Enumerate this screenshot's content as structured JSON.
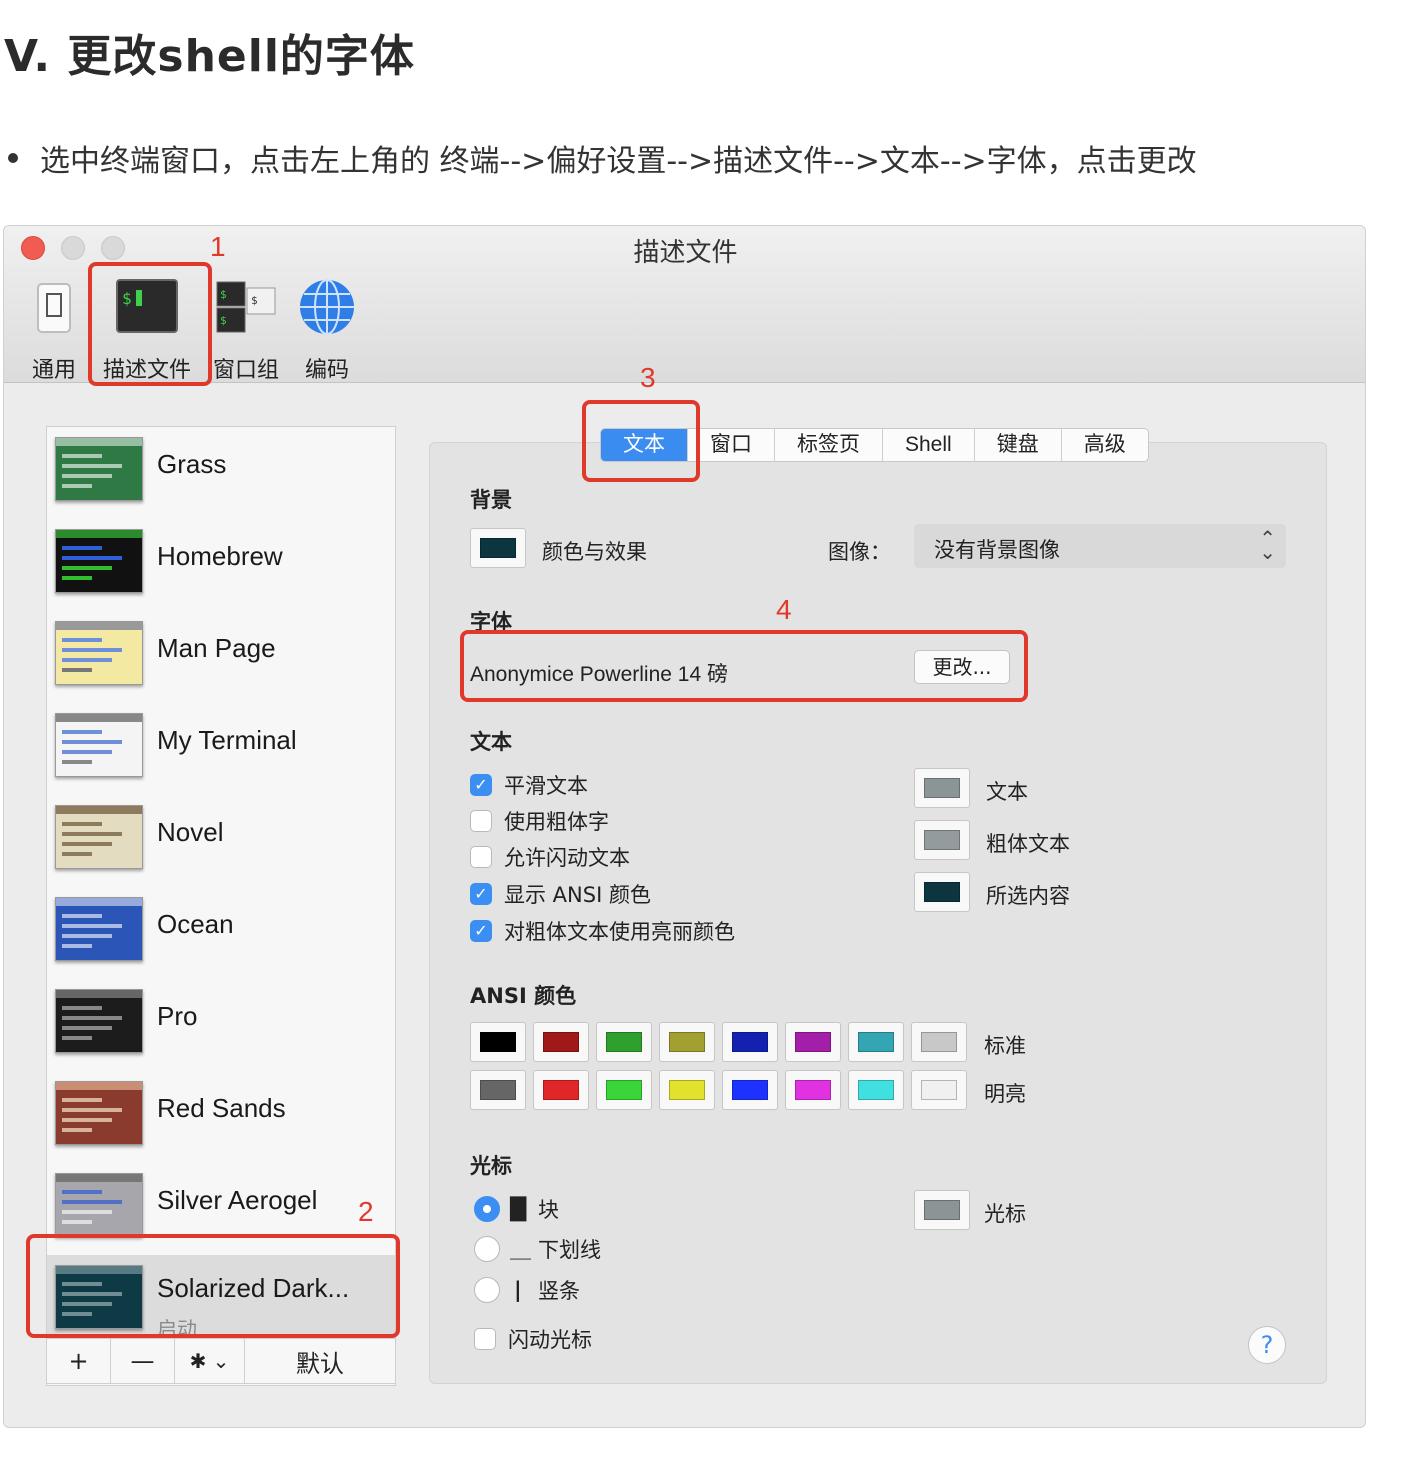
{
  "heading": "V. 更改shell的字体",
  "instruction": "选中终端窗口，点击左上角的 终端-->偏好设置-->描述文件-->文本-->字体，点击更改",
  "window": {
    "title": "描述文件",
    "toolbar": [
      {
        "label": "通用",
        "icon": "phone-icon"
      },
      {
        "label": "描述文件",
        "icon": "terminal-icon"
      },
      {
        "label": "窗口组",
        "icon": "window-group-icon"
      },
      {
        "label": "编码",
        "icon": "globe-icon"
      }
    ]
  },
  "annotations": [
    "1",
    "2",
    "3",
    "4"
  ],
  "profiles": [
    {
      "name": "Grass",
      "color": "#2f7a44"
    },
    {
      "name": "Homebrew",
      "color": "#111111"
    },
    {
      "name": "Man Page",
      "color": "#f3e9a2"
    },
    {
      "name": "My Terminal",
      "color": "#f4f4f4"
    },
    {
      "name": "Novel",
      "color": "#e3dcc1"
    },
    {
      "name": "Ocean",
      "color": "#2b56b8"
    },
    {
      "name": "Pro",
      "color": "#1c1c1c"
    },
    {
      "name": "Red Sands",
      "color": "#8a3b2e"
    },
    {
      "name": "Silver Aerogel",
      "color": "#a6a6ac"
    },
    {
      "name": "Solarized Dark...",
      "color": "#0d3a44",
      "sub": "启动"
    }
  ],
  "list_buttons": {
    "add": "+",
    "remove": "—",
    "gear": "✱ ⌄",
    "default": "默认"
  },
  "tabs": [
    "文本",
    "窗口",
    "标签页",
    "Shell",
    "键盘",
    "高级"
  ],
  "background": {
    "section": "背景",
    "color_effect": "颜色与效果",
    "image_label": "图像：",
    "image_value": "没有背景图像"
  },
  "font": {
    "section": "字体",
    "value": "Anonymice Powerline 14 磅",
    "change_button": "更改..."
  },
  "text": {
    "section": "文本",
    "options": [
      {
        "label": "平滑文本",
        "checked": true
      },
      {
        "label": "使用粗体字",
        "checked": false
      },
      {
        "label": "允许闪动文本",
        "checked": false
      },
      {
        "label": "显示 ANSI 颜色",
        "checked": true
      },
      {
        "label": "对粗体文本使用亮丽颜色",
        "checked": true
      }
    ],
    "colors": [
      {
        "label": "文本",
        "color": "#8b9596"
      },
      {
        "label": "粗体文本",
        "color": "#939b9c"
      },
      {
        "label": "所选内容",
        "color": "#0c3540"
      }
    ]
  },
  "ansi": {
    "section": "ANSI 颜色",
    "normal_label": "标准",
    "bright_label": "明亮",
    "normal": [
      "#000000",
      "#a01818",
      "#2ea02e",
      "#a3a032",
      "#1421b0",
      "#a31faa",
      "#34a6b3",
      "#c8c8c8"
    ],
    "bright": [
      "#666666",
      "#e02626",
      "#39d539",
      "#e2e22e",
      "#1e32ff",
      "#e032e0",
      "#40e0e0",
      "#f0f0f0"
    ]
  },
  "cursor": {
    "section": "光标",
    "options": [
      {
        "glyph": "█",
        "label": "块",
        "selected": true
      },
      {
        "glyph": "＿",
        "label": "下划线",
        "selected": false
      },
      {
        "glyph": "|",
        "label": "竖条",
        "selected": false
      }
    ],
    "blink": "闪动光标",
    "color_label": "光标",
    "color": "#8b9596"
  },
  "help": "?"
}
